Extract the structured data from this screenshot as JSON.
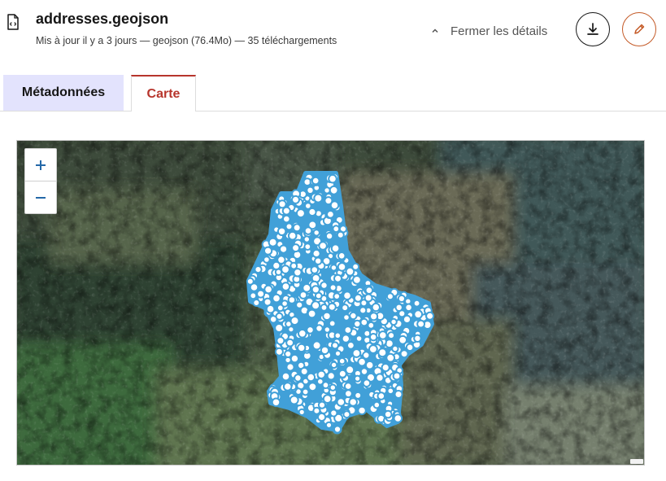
{
  "file": {
    "icon": "code-file-icon",
    "name": "addresses.geojson",
    "meta": "Mis à jour il y a 3 jours — geojson (76.4Mo) — 35 téléchargements"
  },
  "actions": {
    "toggle_details_label": "Fermer les détails",
    "toggle_icon": "chevron-up-icon",
    "download_icon": "download-icon",
    "edit_icon": "pencil-icon"
  },
  "tabs": [
    {
      "label": "Métadonnées",
      "selected": false
    },
    {
      "label": "Carte",
      "selected": true
    }
  ],
  "map": {
    "basemap": "satellite imagery",
    "zoom_in_label": "+",
    "zoom_out_label": "–",
    "marker_color": "#41a0d8",
    "zoom_in_icon": "plus-icon",
    "zoom_out_icon": "minus-icon"
  },
  "colors": {
    "accent_red": "#b7352c",
    "edit_orange": "#c45a27",
    "tab_inactive_bg": "#e3e3fd"
  }
}
